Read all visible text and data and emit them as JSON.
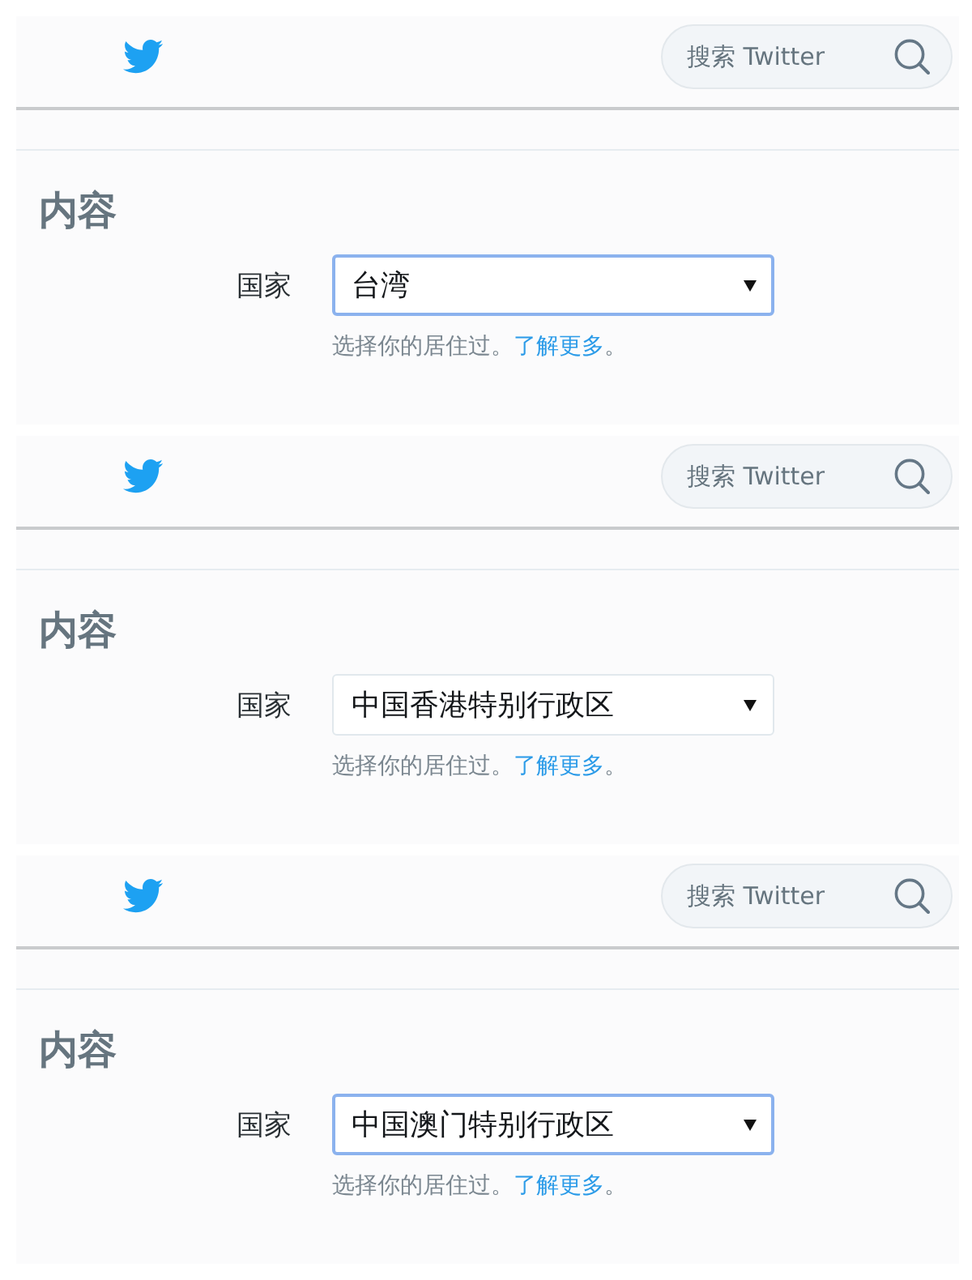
{
  "panels": [
    {
      "header": {
        "search": {
          "placeholder": "搜索 Twitter"
        }
      },
      "section": {
        "title": "内容",
        "field": {
          "label": "国家",
          "value": "台湾",
          "focused": true
        },
        "help": {
          "text": "选择你的居住过。",
          "link": "了解更多",
          "suffix": "。"
        }
      }
    },
    {
      "header": {
        "search": {
          "placeholder": "搜索 Twitter"
        }
      },
      "section": {
        "title": "内容",
        "field": {
          "label": "国家",
          "value": "中国香港特别行政区",
          "focused": false
        },
        "help": {
          "text": "选择你的居住过。",
          "link": "了解更多",
          "suffix": "。"
        }
      }
    },
    {
      "header": {
        "search": {
          "placeholder": "搜索 Twitter"
        }
      },
      "section": {
        "title": "内容",
        "field": {
          "label": "国家",
          "value": "中国澳门特别行政区",
          "focused": true
        },
        "help": {
          "text": "选择你的居住过。",
          "link": "了解更多",
          "suffix": "。"
        }
      }
    }
  ]
}
